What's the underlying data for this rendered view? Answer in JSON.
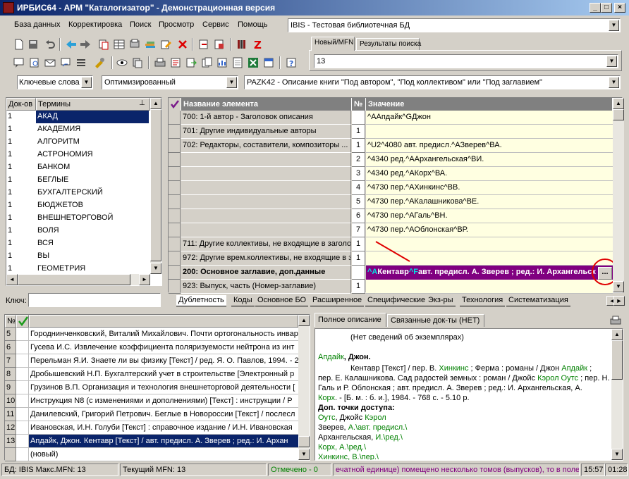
{
  "window": {
    "title": "ИРБИС64 - АРМ \"Каталогизатор\" - Демонстрационная версия"
  },
  "menu": [
    "База данных",
    "Корректировка",
    "Поиск",
    "Просмотр",
    "Сервис",
    "Помощь"
  ],
  "db_select": "IBIS - Тестовая библиотечная БД",
  "right_tabs": [
    "Новый/MFN",
    "Результаты поиска"
  ],
  "mfn_input": "13",
  "search": {
    "mode": "Ключевые слова",
    "optimization": "Оптимизированный",
    "worksheet": "PAZK42 - Описание книги \"Под автором\", \"Под коллективом\" или \"Под заглавием\""
  },
  "terms": {
    "headers": [
      "Док-ов",
      "Термины"
    ],
    "rows": [
      {
        "count": "1",
        "term": "АКАД"
      },
      {
        "count": "1",
        "term": "АКАДЕМИЯ"
      },
      {
        "count": "1",
        "term": "АЛГОРИТМ"
      },
      {
        "count": "1",
        "term": "АСТРОНОМИЯ"
      },
      {
        "count": "1",
        "term": "БАНКОМ"
      },
      {
        "count": "1",
        "term": "БЕГЛЫЕ"
      },
      {
        "count": "1",
        "term": "БУХГАЛТЕРСКИЙ"
      },
      {
        "count": "1",
        "term": "БЮДЖЕТОВ"
      },
      {
        "count": "1",
        "term": "ВНЕШНЕТОРГОВОЙ"
      },
      {
        "count": "1",
        "term": "ВОЛЯ"
      },
      {
        "count": "1",
        "term": "ВСЯ"
      },
      {
        "count": "1",
        "term": "ВЫ"
      },
      {
        "count": "1",
        "term": "ГЕОМЕТРИЯ"
      }
    ],
    "key_label": "Ключ:",
    "key_value": ""
  },
  "fields": {
    "headers": [
      "Название элемента",
      "№",
      "Значение"
    ],
    "rows": [
      {
        "name": "700: 1-й автор - Заголовок описания",
        "num": "",
        "value": "^AАпдайк^GДжон"
      },
      {
        "name": "701: Другие индивидуальные авторы",
        "num": "1",
        "value": ""
      },
      {
        "name": "702: Редакторы, составители, композиторы ...",
        "num": "1",
        "value": "^U2^4080 авт. предисл.^AЗверев^ВА."
      },
      {
        "name": "",
        "num": "2",
        "value": "^4340 ред.^AАрхангельская^ВИ."
      },
      {
        "name": "",
        "num": "3",
        "value": "^4340 ред.^AКорх^ВА."
      },
      {
        "name": "",
        "num": "4",
        "value": "^4730 пер.^AХинкинс^ВВ."
      },
      {
        "name": "",
        "num": "5",
        "value": "^4730 пер.^AКалашникова^ВЕ."
      },
      {
        "name": "",
        "num": "6",
        "value": "^4730 пер.^AГаль^ВН."
      },
      {
        "name": "",
        "num": "7",
        "value": "^4730 пер.^AОблонская^ВР."
      },
      {
        "name": "711: Другие коллективы, не входящие в заголовок",
        "num": "1",
        "value": ""
      },
      {
        "name": "972: Другие врем.коллективы, не входящие в заг.",
        "num": "1",
        "value": ""
      },
      {
        "name": "200: Основное заглавие, доп.данные",
        "num": "",
        "value": ""
      },
      {
        "name": "923: Выпуск, часть (Номер-заглавие)",
        "num": "1",
        "value": ""
      }
    ],
    "selected_value": {
      "m1": "^A",
      "p1": "Кентавр",
      "m2": "^F",
      "p2": "авт. предисл. А. Зверев ; ред.: И. Архангельск"
    },
    "ellipsis": "..."
  },
  "worksheet_tabs": [
    "Дублетность",
    "Коды",
    "Основное БО",
    "Расширенное",
    "Специфические",
    "Экз-ры",
    "Технология",
    "Систематизация"
  ],
  "records": {
    "headers": [
      "№"
    ],
    "rows": [
      {
        "n": "5",
        "text": "Городнинченковский, Виталий Михайлович. Почти ортогональность инвар"
      },
      {
        "n": "6",
        "text": "Гусева И.С. Извлечение коэффициента поляризуемости нейтрона из инт"
      },
      {
        "n": "7",
        "text": "Перельман Я.И. Знаете ли вы физику [Текст] / ред. Я. О. Павлов, 1994. - 2"
      },
      {
        "n": "8",
        "text": "Дробышевский Н.П. Бухгалтерский учет в строительстве [Электронный р"
      },
      {
        "n": "9",
        "text": "Грузинов В.П. Организация и технология внешнеторговой деятельности ["
      },
      {
        "n": "10",
        "text": "Инструкция N8   (с изменениями и дополнениями) [Текст] : инструкции / Р"
      },
      {
        "n": "11",
        "text": "Данилевский, Григорий Петрович. Беглые в Новороссии [Текст] / послесл"
      },
      {
        "n": "12",
        "text": "Ивановская, И.Н. Голуби [Текст] : справочное издание / И.Н. Ивановская"
      },
      {
        "n": "13",
        "text": "Апдайк, Джон. Кентавр [Текст] / авт. предисл. А. Зверев ; ред.: И. Архан"
      },
      {
        "n": "",
        "text": "(новый)"
      }
    ]
  },
  "preview": {
    "tabs": [
      "Полное описание",
      "Связанные док-ты (НЕТ)"
    ],
    "no_copies": "(Нет сведений об экземплярах)",
    "author_link": "Апдайк",
    "author_rest": ", Джон.",
    "line1_a": "Кентавр [Текст] / пер. В. ",
    "line1_link1": "Хинкинс",
    "line1_b": " ; Ферма : романы / Джон ",
    "line1_link2": "Апдайк",
    "line1_c": " ;",
    "line2_a": "пер. Е. Калашникова. Сад радостей земных : роман / Джойс ",
    "line2_link": "Кэрол Оутс",
    "line2_b": " ; пер. Н.",
    "line3": "Галь и Р. Облонская ; авт. предисл. А. Зверев ; ред.: И. Архангельская, А.",
    "line4_link": "Корх",
    "line4_rest": ". - [Б. м. : б. и.], 1984. - 768 с. - 5.10 р.",
    "dop_title": "Доп. точки доступа:",
    "ap1_link": "Оутс",
    "ap1_rest": ", Джойс ",
    "ap1_link2": "Кэрол",
    "ap2_a": "Зверев, ",
    "ap2_link": "А.\\авт. предисл.\\",
    "ap3_a": "Архангельская, ",
    "ap3_link": "И.\\ред.\\",
    "ap4_link": "Корх, А.\\ред.\\",
    "ap5_link": "Хинкинс, В.\\пер.\\"
  },
  "status": {
    "db": "БД: IBIS Макс.MFN: 13",
    "current": "Текущий MFN: 13",
    "marked": "Отмечено - 0",
    "message": "ечатной единице) помещено несколько томов (выпусков), то в поле",
    "time": "15:57",
    "clock": "01:28"
  },
  "colors": {
    "selection": "#0a246a",
    "field_value_bg": "#ffffe1",
    "highlight": "#800080",
    "link": "#008000",
    "annotation": "#e00000"
  }
}
